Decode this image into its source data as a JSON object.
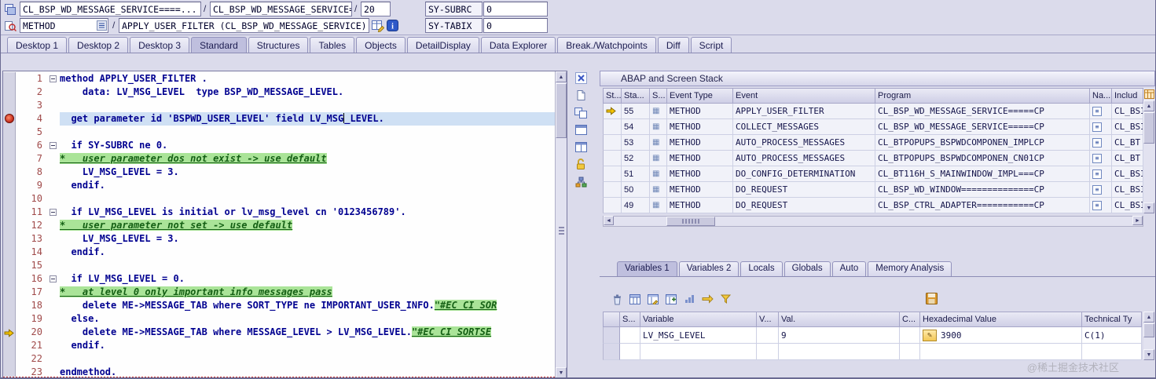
{
  "window": {
    "watermark": "@稀土掘金技术社区"
  },
  "topbar": {
    "row1": {
      "program_field": "CL_BSP_WD_MESSAGE_SERVICE====...",
      "slash": "/",
      "include_field": "CL_BSP_WD_MESSAGE_SERVICE====..",
      "line_field": "20",
      "sy_subrc": {
        "label": "SY-SUBRC",
        "value": "0"
      }
    },
    "row2": {
      "event_type_field": "METHOD",
      "slash": "/",
      "event_field": "APPLY_USER_FILTER (CL_BSP_WD_MESSAGE_SERVICE)",
      "sy_tabix": {
        "label": "SY-TABIX",
        "value": "0"
      }
    }
  },
  "tabs": {
    "active": "Standard",
    "items": [
      "Desktop 1",
      "Desktop 2",
      "Desktop 3",
      "Standard",
      "Structures",
      "Tables",
      "Objects",
      "DetailDisplay",
      "Data Explorer",
      "Break./Watchpoints",
      "Diff",
      "Script"
    ]
  },
  "editor": {
    "lines": [
      {
        "n": 1,
        "fold": true,
        "segments": [
          [
            "c",
            "method APPLY_USER_FILTER ."
          ]
        ]
      },
      {
        "n": 2,
        "segments": [
          [
            "c",
            "    data: LV_MSG_LEVEL  type BSP_WD_MESSAGE_LEVEL."
          ]
        ]
      },
      {
        "n": 3,
        "segments": []
      },
      {
        "n": 4,
        "breakpoint": true,
        "highlight": true,
        "segments": [
          [
            "c",
            "  get parameter id 'BSPWD_USER_LEVEL' field LV_MSG"
          ],
          [
            "caret",
            ""
          ],
          [
            "c",
            "_LEVEL."
          ]
        ]
      },
      {
        "n": 5,
        "segments": []
      },
      {
        "n": 6,
        "fold": true,
        "segments": [
          [
            "c",
            "  if SY-SUBRC ne 0."
          ]
        ]
      },
      {
        "n": 7,
        "segments": [
          [
            "cm",
            "*   user parameter dos not exist -> use default"
          ]
        ]
      },
      {
        "n": 8,
        "segments": [
          [
            "c",
            "    LV_MSG_LEVEL = 3."
          ]
        ]
      },
      {
        "n": 9,
        "segments": [
          [
            "c",
            "  endif."
          ]
        ]
      },
      {
        "n": 10,
        "segments": []
      },
      {
        "n": 11,
        "fold": true,
        "segments": [
          [
            "c",
            "  if LV_MSG_LEVEL is initial or lv_msg_level cn '0123456789'."
          ]
        ]
      },
      {
        "n": 12,
        "segments": [
          [
            "cm",
            "*   user parameter not set -> use default"
          ]
        ]
      },
      {
        "n": 13,
        "segments": [
          [
            "c",
            "    LV_MSG_LEVEL = 3."
          ]
        ]
      },
      {
        "n": 14,
        "segments": [
          [
            "c",
            "  endif."
          ]
        ]
      },
      {
        "n": 15,
        "segments": []
      },
      {
        "n": 16,
        "fold": true,
        "segments": [
          [
            "c",
            "  if LV_MSG_LEVEL = 0."
          ]
        ]
      },
      {
        "n": 17,
        "segments": [
          [
            "cm",
            "*   at level 0 only important info messages pass"
          ]
        ]
      },
      {
        "n": 18,
        "segments": [
          [
            "c",
            "    delete ME->MESSAGE_TAB where SORT_TYPE ne IMPORTANT_USER_INFO."
          ],
          [
            "ec",
            "\"#EC CI SOR"
          ]
        ]
      },
      {
        "n": 19,
        "segments": [
          [
            "c",
            "  else."
          ]
        ]
      },
      {
        "n": 20,
        "current": true,
        "segments": [
          [
            "c",
            "    delete ME->MESSAGE_TAB where MESSAGE_LEVEL > LV_MSG_LEVEL."
          ],
          [
            "ec",
            "\"#EC CI SORTSE"
          ]
        ]
      },
      {
        "n": 21,
        "segments": [
          [
            "c",
            "  endif."
          ]
        ]
      },
      {
        "n": 22,
        "segments": []
      },
      {
        "n": 23,
        "segments": [
          [
            "c",
            "endmethod."
          ]
        ]
      }
    ]
  },
  "stack": {
    "title": "ABAP and Screen Stack",
    "columns": [
      "St...",
      "Sta...",
      "S...",
      "Event Type",
      "Event",
      "Program",
      "Na...",
      "Includ"
    ],
    "rows": [
      {
        "current": true,
        "level": "55",
        "event_type": "METHOD",
        "event": "APPLY_USER_FILTER",
        "program": "CL_BSP_WD_MESSAGE_SERVICE=====CP",
        "include": "CL_BSI"
      },
      {
        "current": false,
        "level": "54",
        "event_type": "METHOD",
        "event": "COLLECT_MESSAGES",
        "program": "CL_BSP_WD_MESSAGE_SERVICE=====CP",
        "include": "CL_BSI"
      },
      {
        "current": false,
        "level": "53",
        "event_type": "METHOD",
        "event": "AUTO_PROCESS_MESSAGES",
        "program": "CL_BTPOPUPS_BSPWDCOMPONEN_IMPLCP",
        "include": "CL_BT"
      },
      {
        "current": false,
        "level": "52",
        "event_type": "METHOD",
        "event": "AUTO_PROCESS_MESSAGES",
        "program": "CL_BTPOPUPS_BSPWDCOMPONEN_CN01CP",
        "include": "CL_BT"
      },
      {
        "current": false,
        "level": "51",
        "event_type": "METHOD",
        "event": "DO_CONFIG_DETERMINATION",
        "program": "CL_BT116H_S_MAINWINDOW_IMPL===CP",
        "include": "CL_BSI"
      },
      {
        "current": false,
        "level": "50",
        "event_type": "METHOD",
        "event": "DO_REQUEST",
        "program": "CL_BSP_WD_WINDOW==============CP",
        "include": "CL_BSI"
      },
      {
        "current": false,
        "level": "49",
        "event_type": "METHOD",
        "event": "DO_REQUEST",
        "program": "CL_BSP_CTRL_ADAPTER===========CP",
        "include": "CL_BSI"
      }
    ]
  },
  "variables": {
    "tabs": [
      "Variables 1",
      "Variables 2",
      "Locals",
      "Globals",
      "Auto",
      "Memory Analysis"
    ],
    "active_tab": "Variables 1",
    "columns": [
      "S...",
      "Variable",
      "V...",
      "Val.",
      "C...",
      "Hexadecimal Value",
      "Technical Ty"
    ],
    "rows": [
      {
        "variable": "LV_MSG_LEVEL",
        "val": "9",
        "hex": "3900",
        "tech": "C(1)",
        "editable": true
      },
      {
        "variable": "",
        "val": "",
        "hex": "",
        "tech": "",
        "editable": false
      }
    ]
  }
}
